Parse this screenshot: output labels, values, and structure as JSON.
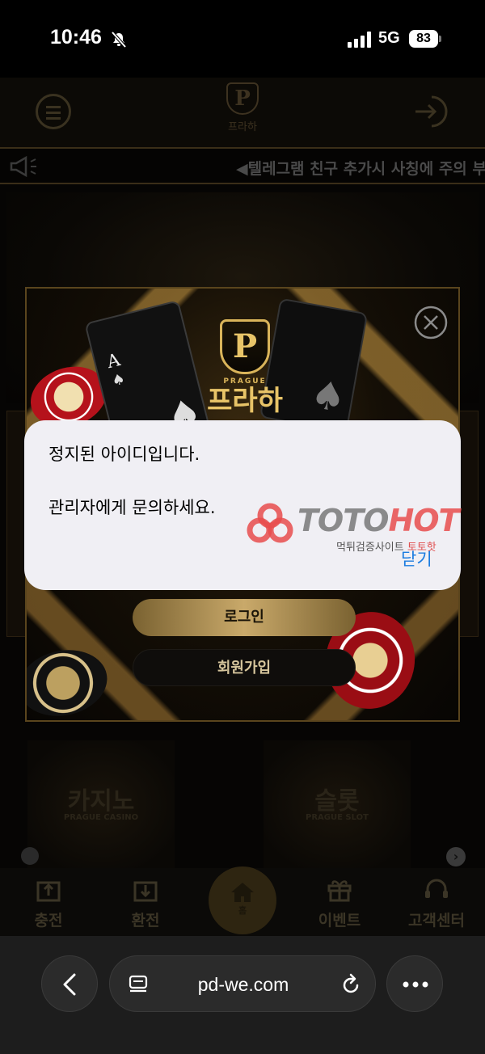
{
  "status_bar": {
    "time": "10:46",
    "network": "5G",
    "battery": "83"
  },
  "site": {
    "logo_letter": "P",
    "logo_name": "프라하",
    "marquee": "◀텔레그램 친구 추가시 사칭에 주의 부탁"
  },
  "popup": {
    "logo_letter": "P",
    "logo_sub": "PRAGUE",
    "logo_name": "프라하",
    "card_rank": "A",
    "login_label": "로그인",
    "signup_label": "회원가입"
  },
  "alert": {
    "line1": "정지된 아이디입니다.",
    "line2": "관리자에게 문의하세요.",
    "close_label": "닫기"
  },
  "watermark": {
    "brand_part1": "TOTO",
    "brand_part2": "HOT",
    "tagline": "먹튀검증사이트 ",
    "tagline_highlight": "토토핫"
  },
  "games": [
    {
      "title": "카지노",
      "subtitle": "PRAGUE CASINO"
    },
    {
      "title": "슬롯",
      "subtitle": "PRAGUE SLOT"
    }
  ],
  "nav": {
    "charge": "충전",
    "withdraw": "환전",
    "home": "홈",
    "event": "이벤트",
    "support": "고객센터"
  },
  "browser": {
    "url": "pd-we.com"
  },
  "colors": {
    "gold": "#d9b45a",
    "alert_bg": "#f0eff4",
    "link_blue": "#1c7ce0",
    "watermark_red": "#e84c4c"
  }
}
